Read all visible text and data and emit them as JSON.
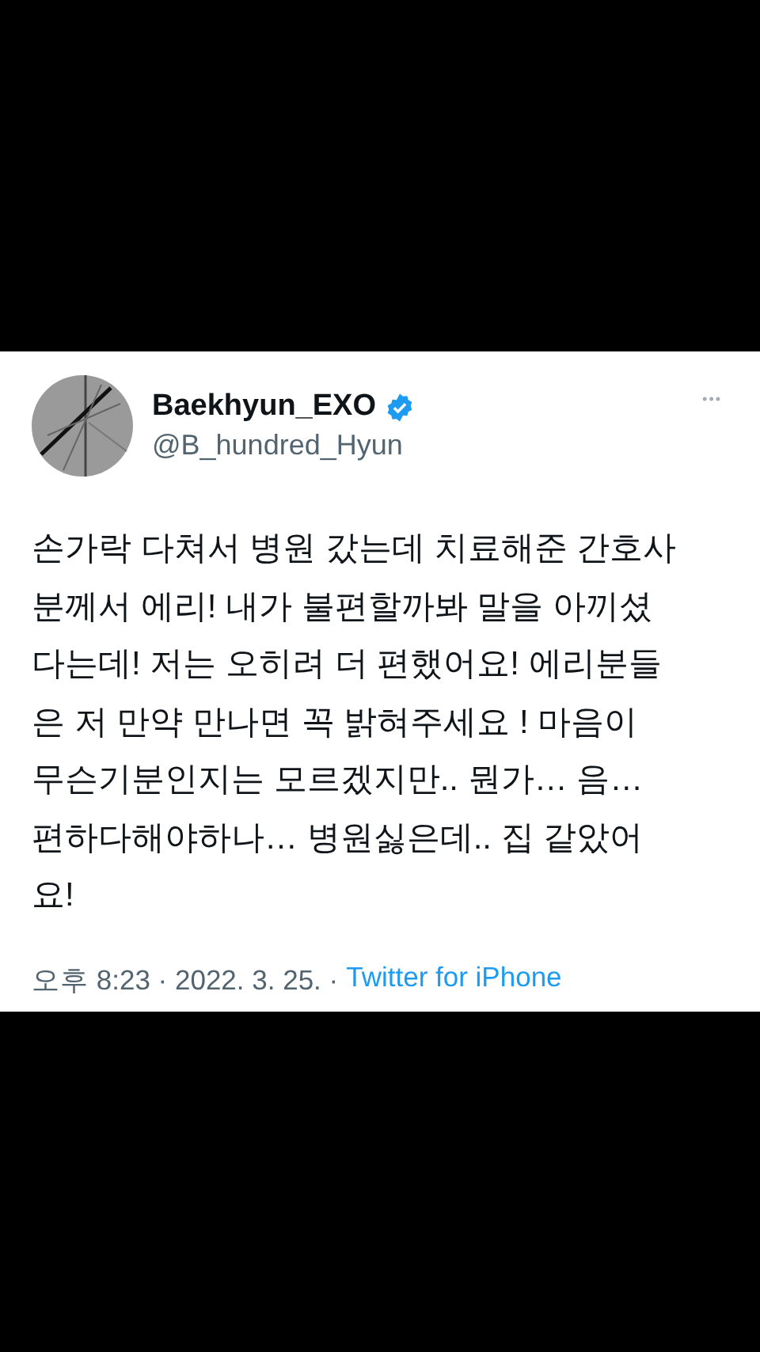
{
  "tweet": {
    "author": {
      "name": "Baekhyun_EXO",
      "verified": true,
      "handle": "@B_hundred_Hyun"
    },
    "more": "•••",
    "text": "손가락 다쳐서 병원 갔는데 치료해준 간호사\n분께서 에리! 내가 불편할까봐 말을 아끼셨\n다는데! 저는 오히려 더 편했어요! 에리분들\n은 저 만약 만나면 꼭 밝혀주세요 ! 마음이\n무슨기분인지는 모르겠지만.. 뭔가… 음…\n편하다해야하나… 병원싫은데.. 집 같았어\n요!",
    "timestamp": "오후 8:23 · 2022. 3. 25. ·",
    "source": "Twitter for iPhone"
  }
}
